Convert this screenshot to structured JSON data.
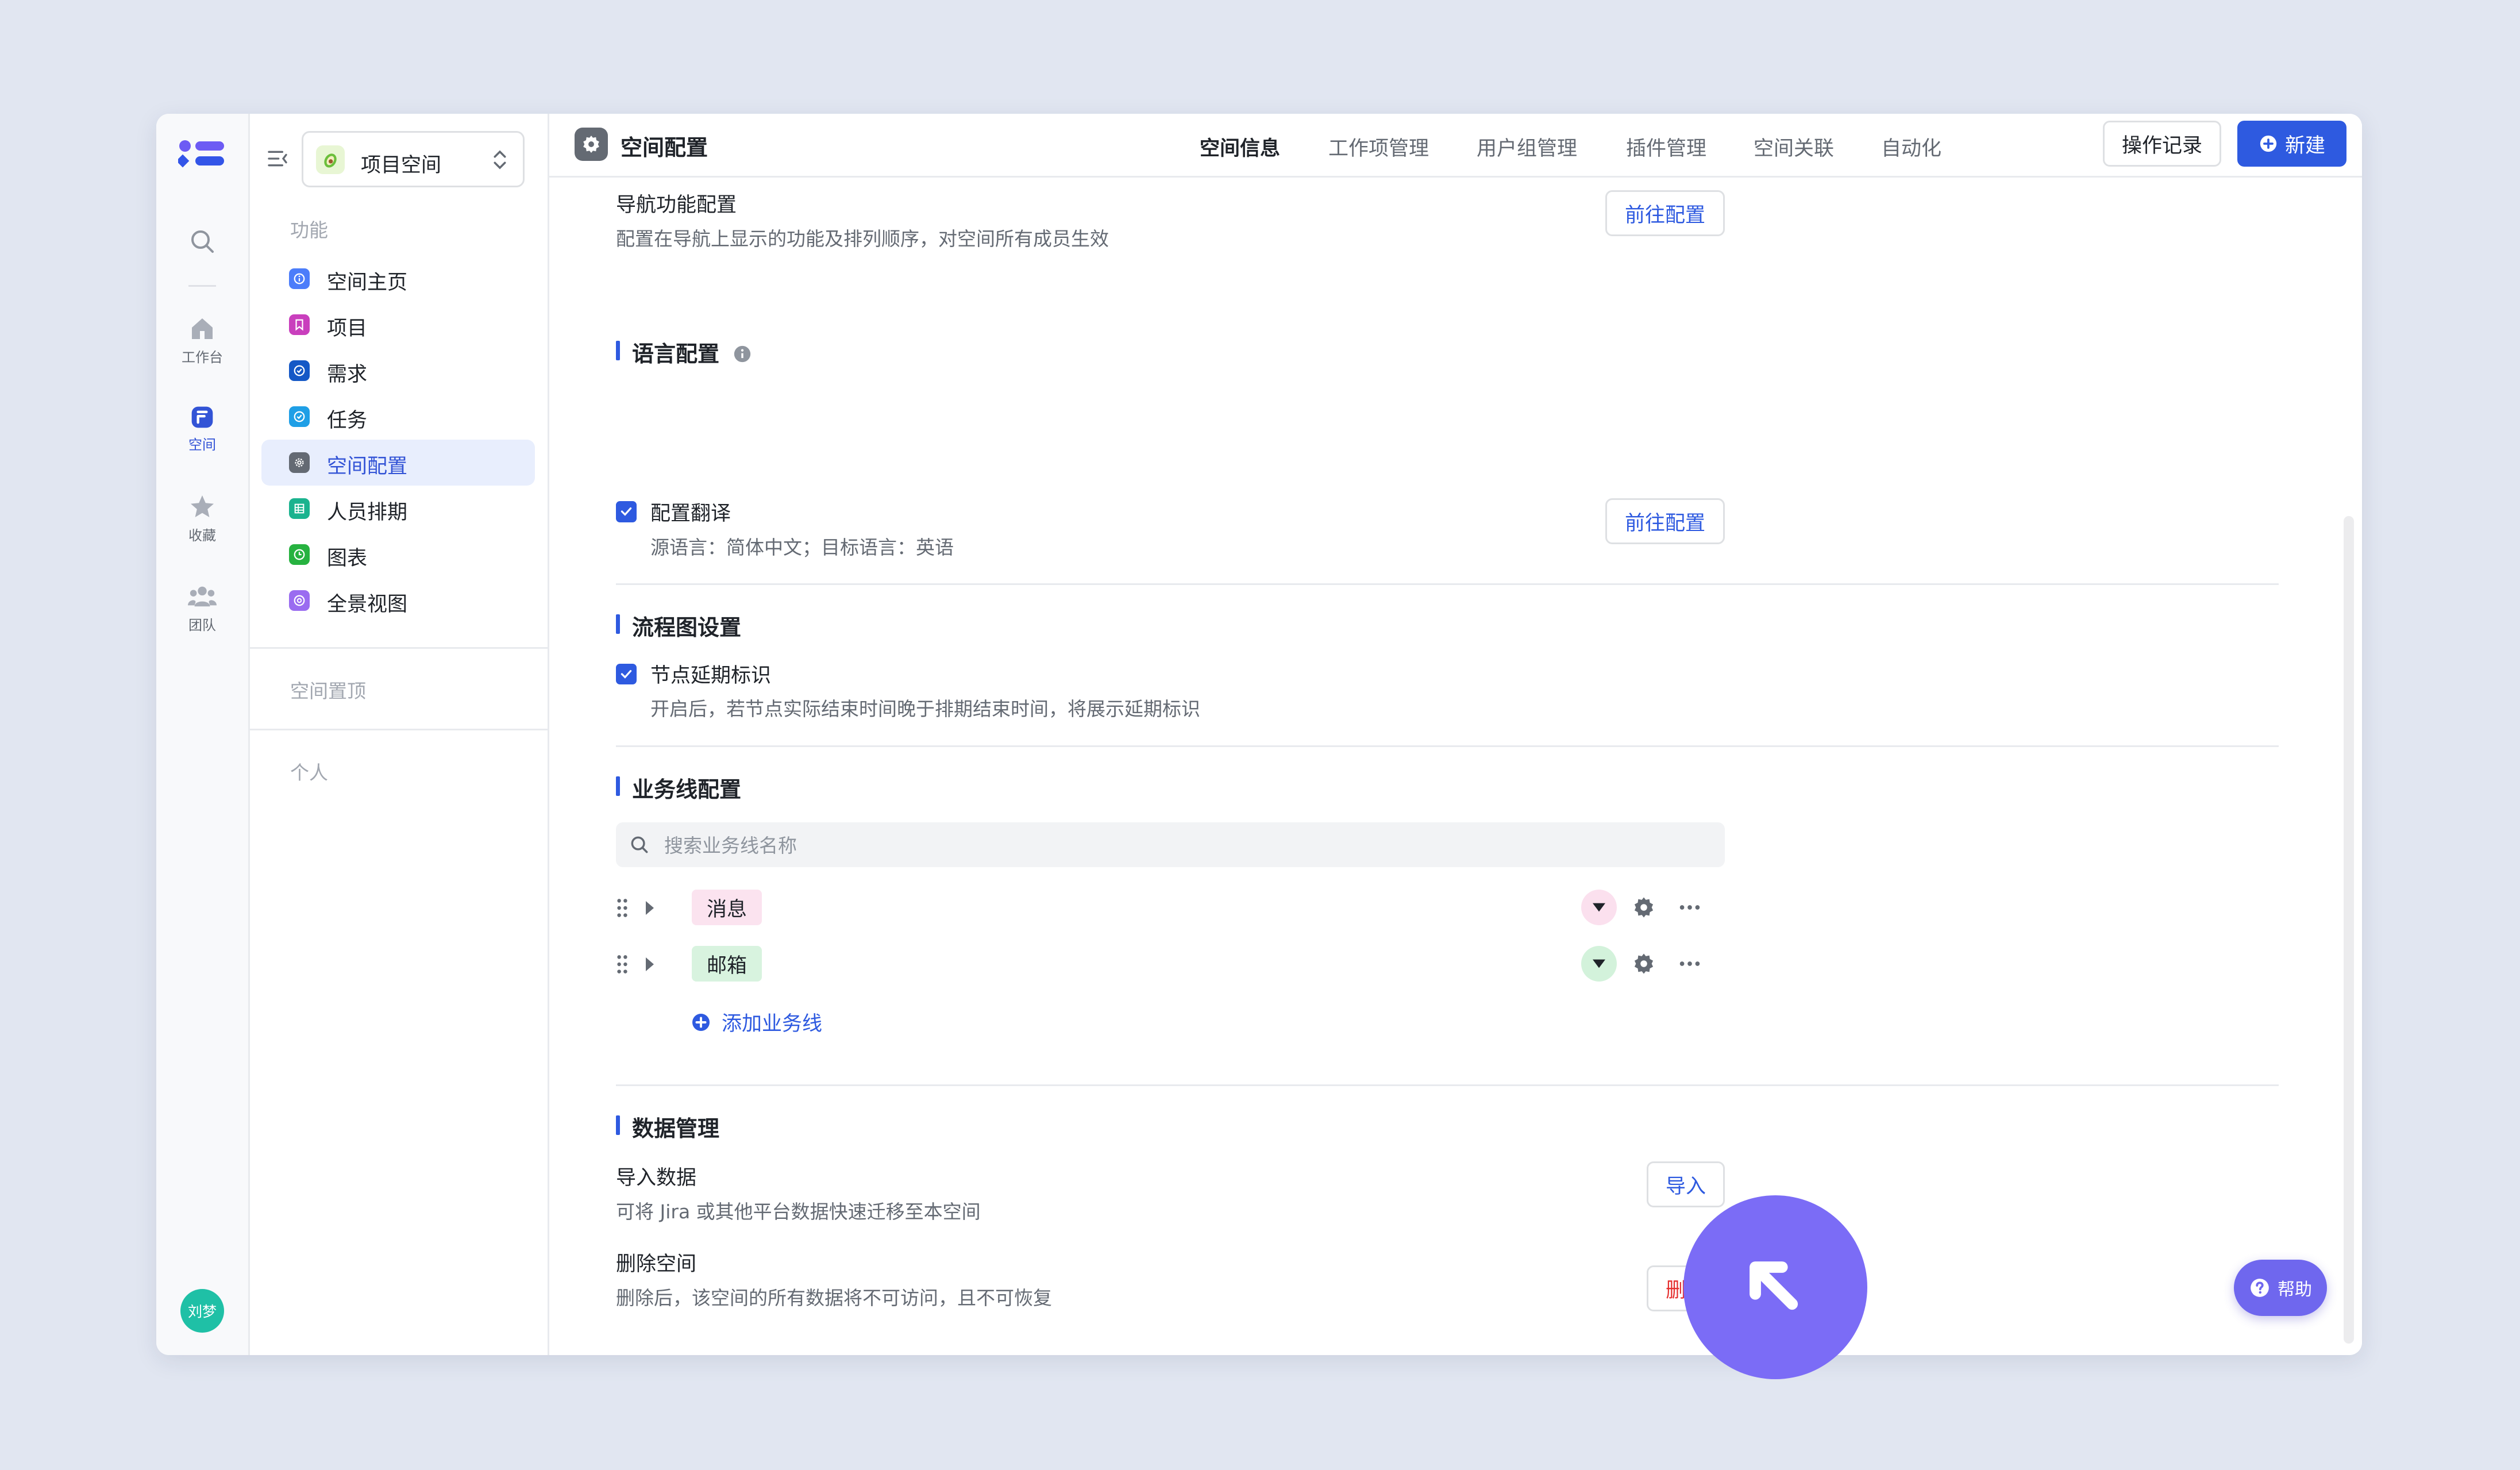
{
  "rail": {
    "items": [
      {
        "icon": "search-icon",
        "label": ""
      },
      {
        "icon": "home-icon",
        "label": "工作台"
      },
      {
        "icon": "space-icon",
        "label": "空间"
      },
      {
        "icon": "star-icon",
        "label": "收藏"
      },
      {
        "icon": "team-icon",
        "label": "团队"
      }
    ],
    "avatar": "刘梦"
  },
  "sidebar": {
    "space_name": "项目空间",
    "group_feature": "功能",
    "items": [
      {
        "label": "空间主页",
        "color": "#4c7dfa"
      },
      {
        "label": "项目",
        "color": "#c93fbd"
      },
      {
        "label": "需求",
        "color": "#1458c6"
      },
      {
        "label": "任务",
        "color": "#1f9fe6"
      },
      {
        "label": "空间配置",
        "color": "#646a73"
      },
      {
        "label": "人员排期",
        "color": "#1bb38f"
      },
      {
        "label": "图表",
        "color": "#27b240"
      },
      {
        "label": "全景视图",
        "color": "#9a6cf0"
      }
    ],
    "group_pinned": "空间置顶",
    "group_personal": "个人"
  },
  "header": {
    "title": "空间配置",
    "tabs": [
      "空间信息",
      "工作项管理",
      "用户组管理",
      "插件管理",
      "空间关联",
      "自动化"
    ],
    "record_label": "操作记录",
    "new_label": "新建"
  },
  "nav_config": {
    "title": "导航功能配置",
    "desc": "配置在导航上显示的功能及排列顺序，对空间所有成员生效",
    "button": "前往配置"
  },
  "language": {
    "title": "语言配置",
    "check_label": "配置翻译",
    "desc": "源语言：简体中文；目标语言：英语",
    "button": "前往配置"
  },
  "flow": {
    "title": "流程图设置",
    "check_label": "节点延期标识",
    "desc": "开启后，若节点实际结束时间晚于排期结束时间，将展示延期标识"
  },
  "business": {
    "title": "业务线配置",
    "search_placeholder": "搜索业务线名称",
    "lines": [
      {
        "name": "消息",
        "tag_color": "#fbe3ef",
        "dot_color": "#fbe0ee"
      },
      {
        "name": "邮箱",
        "tag_color": "#d8f3df",
        "dot_color": "#d3f2db"
      }
    ],
    "add_label": "添加业务线"
  },
  "data": {
    "title": "数据管理",
    "import_title": "导入数据",
    "import_desc": "可将 Jira 或其他平台数据快速迁移至本空间",
    "import_button": "导入",
    "delete_title": "删除空间",
    "delete_desc": "删除后，该空间的所有数据将不可访问，且不可恢复",
    "delete_button": "删除"
  },
  "help_label": "帮助"
}
